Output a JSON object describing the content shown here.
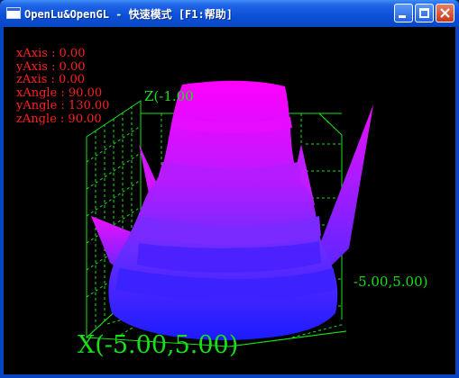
{
  "window": {
    "title": "OpenLu&OpenGL - 快速模式 [F1:帮助]",
    "icon": "app-window-icon",
    "buttons": [
      {
        "name": "minimize",
        "icon": "minimize-icon"
      },
      {
        "name": "maximize",
        "icon": "maximize-icon"
      },
      {
        "name": "close",
        "icon": "close-icon"
      }
    ]
  },
  "info": {
    "lines": [
      "xAxis : 0.00",
      "yAxis : 0.00",
      "zAxis : 0.00",
      "xAngle : 90.00",
      "yAngle : 130.00",
      "zAngle : 90.00"
    ]
  },
  "axes": {
    "z_label": "Z(-1.00",
    "y_label": "-5.00,5.00)",
    "x_label": "X(-5.00,5.00)"
  },
  "colors": {
    "background": "#000000",
    "info_text": "#ff2020",
    "grid": "#18e018",
    "surface_top": "#ff00ff",
    "surface_bottom": "#2020ff"
  }
}
